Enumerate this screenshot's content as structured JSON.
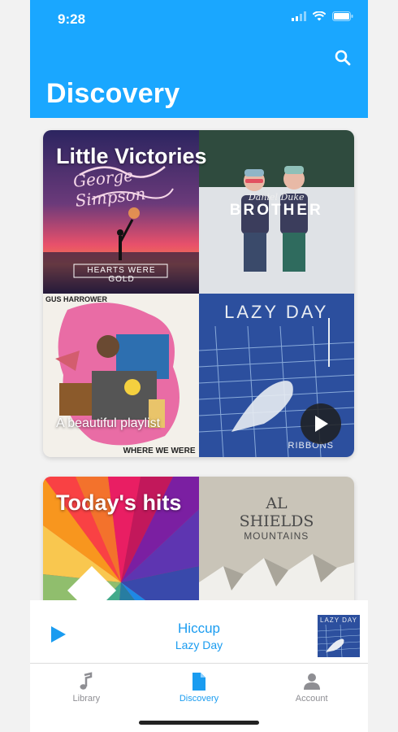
{
  "status": {
    "time": "9:28"
  },
  "header": {
    "title": "Discovery"
  },
  "cards": [
    {
      "title": "Little Victories",
      "subtitle": "A beautiful playlist",
      "covers": [
        {
          "artist": "George Simpson",
          "album": "HEARTS WERE GOLD"
        },
        {
          "artist": "Daniel Duke",
          "album": "BROTHER"
        },
        {
          "artist": "GUS HARROWER",
          "album": "WHERE WE WERE"
        },
        {
          "artist": "RIBBONS",
          "album": "LAZY DAY"
        }
      ]
    },
    {
      "title": "Today's hits",
      "covers": [
        {
          "artist": "AL SHIELDS",
          "album": "MOUNTAINS"
        }
      ]
    }
  ],
  "player": {
    "track": "Hiccup",
    "artist": "Lazy Day",
    "art_label": "LAZY DAY"
  },
  "tabs": [
    {
      "label": "Library"
    },
    {
      "label": "Discovery"
    },
    {
      "label": "Account"
    }
  ]
}
